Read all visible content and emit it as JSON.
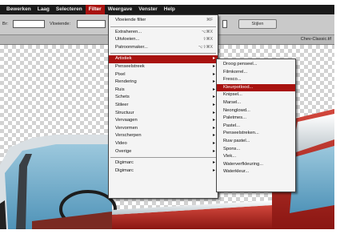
{
  "menubar": {
    "items": [
      "Bewerken",
      "Laag",
      "Selecteren",
      "Filter",
      "Weergave",
      "Venster",
      "Help"
    ],
    "active_index": 3
  },
  "options": {
    "label_1": "Br:",
    "label_2": "Vloeiende:",
    "button_label": "Stijlen"
  },
  "document": {
    "title": "Chev-Classic.tif"
  },
  "filter_menu": {
    "last_filter": {
      "label": "Vloeiende filter",
      "shortcut": "⌘F"
    },
    "group_2": [
      {
        "label": "Extraheren...",
        "shortcut": "⌥⌘X"
      },
      {
        "label": "Uitvloeien...",
        "shortcut": "⇧⌘X"
      },
      {
        "label": "Patroonmaker...",
        "shortcut": "⌥⇧⌘X"
      }
    ],
    "categories": [
      {
        "label": "Artistiek",
        "highlighted": true
      },
      {
        "label": "Penseelstreek"
      },
      {
        "label": "Pixel"
      },
      {
        "label": "Rendering"
      },
      {
        "label": "Ruis"
      },
      {
        "label": "Schets"
      },
      {
        "label": "Stileer"
      },
      {
        "label": "Structuur"
      },
      {
        "label": "Vervaagen"
      },
      {
        "label": "Vervormen"
      },
      {
        "label": "Verscherpen"
      },
      {
        "label": "Video"
      },
      {
        "label": "Overige"
      }
    ],
    "bottom": [
      {
        "label": "Digimarc",
        "submenu": true
      },
      {
        "label": "Digimarc",
        "submenu": true
      }
    ]
  },
  "artistic_submenu": {
    "items": [
      {
        "label": "Droog penseel..."
      },
      {
        "label": "Filmkorrel..."
      },
      {
        "label": "Fresco..."
      },
      {
        "label": "Kleurpotlood...",
        "highlighted": true
      },
      {
        "label": "Knipsel..."
      },
      {
        "label": "Marsel..."
      },
      {
        "label": "Neonglowd..."
      },
      {
        "label": "Paletmes..."
      },
      {
        "label": "Pastel..."
      },
      {
        "label": "Penseelstreken..."
      },
      {
        "label": "Ruw pastel..."
      },
      {
        "label": "Spons..."
      },
      {
        "label": "Vlek..."
      },
      {
        "label": "Waterverfkleuring..."
      },
      {
        "label": "Waterkleur..."
      }
    ]
  },
  "colors": {
    "menubar_bg": "#1a1a1a",
    "highlight": "#a8120f",
    "car_red": "#b3261e",
    "sky_blue": "#6fb0cf",
    "chrome": "#e8ecee"
  },
  "icons": [
    "submenu-arrow-icon"
  ]
}
